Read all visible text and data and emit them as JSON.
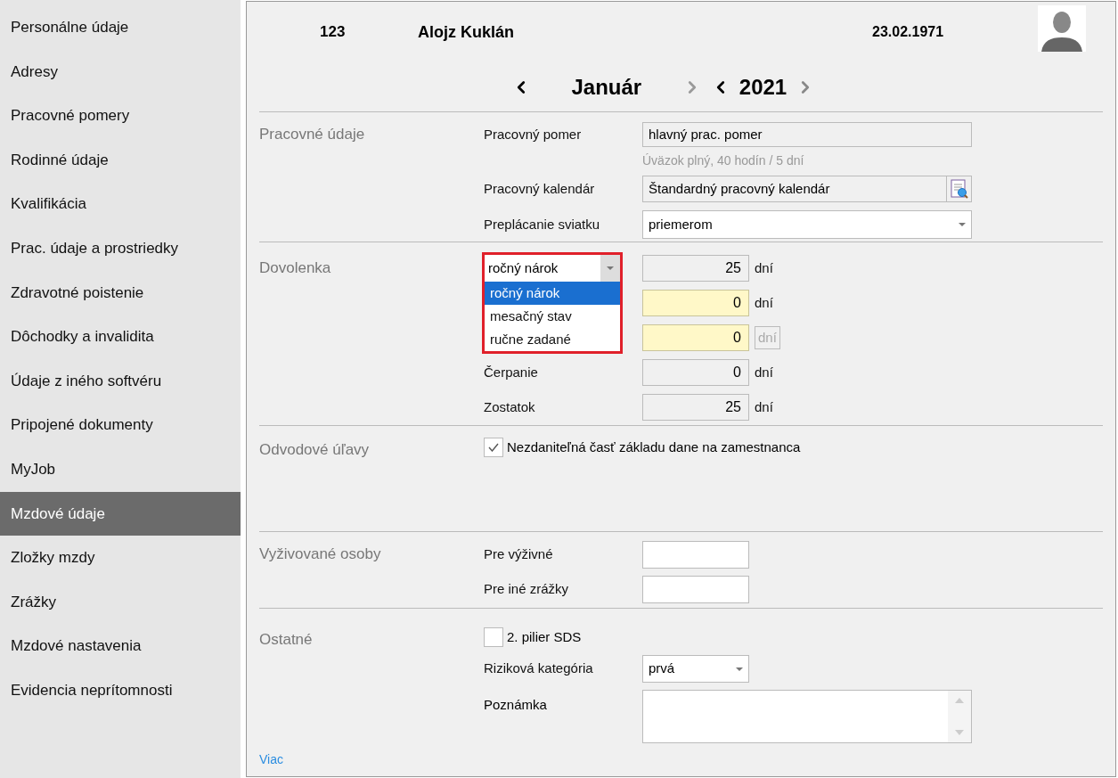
{
  "sidebar": {
    "items": [
      {
        "label": "Personálne údaje",
        "selected": false
      },
      {
        "label": "Adresy",
        "selected": false
      },
      {
        "label": "Pracovné pomery",
        "selected": false
      },
      {
        "label": "Rodinné údaje",
        "selected": false
      },
      {
        "label": "Kvalifikácia",
        "selected": false
      },
      {
        "label": "Prac. údaje a prostriedky",
        "selected": false
      },
      {
        "label": "Zdravotné poistenie",
        "selected": false
      },
      {
        "label": "Dôchodky a invalidita",
        "selected": false
      },
      {
        "label": "Údaje z iného softvéru",
        "selected": false
      },
      {
        "label": "Pripojené dokumenty",
        "selected": false
      },
      {
        "label": "MyJob",
        "selected": false
      },
      {
        "label": "Mzdové údaje",
        "selected": true
      },
      {
        "label": "Zložky mzdy",
        "selected": false
      },
      {
        "label": "Zrážky",
        "selected": false
      },
      {
        "label": "Mzdové nastavenia",
        "selected": false
      },
      {
        "label": "Evidencia neprítomnosti",
        "selected": false
      }
    ]
  },
  "header": {
    "number": "123",
    "name": "Alojz Kuklán",
    "birth_date": "23.02.1971"
  },
  "period": {
    "month": "Január",
    "year": "2021",
    "next_month_disabled": true
  },
  "work": {
    "title": "Pracovné údaje",
    "relation_label": "Pracovný pomer",
    "relation_value": "hlavný prac. pomer",
    "relation_note": "Úväzok plný, 40 hodín  / 5 dní",
    "calendar_label": "Pracovný kalendár",
    "calendar_value": "Štandardný pracovný kalendár",
    "holiday_label": "Preplácanie sviatku",
    "holiday_value": "priemerom"
  },
  "vacation": {
    "title": "Dovolenka",
    "mode_value": "ročný nárok",
    "options": [
      {
        "label": "ročný nárok",
        "selected": true
      },
      {
        "label": "mesačný stav",
        "selected": false
      },
      {
        "label": "ručne zadané",
        "selected": false
      }
    ],
    "rows": [
      {
        "value": "25",
        "unit": "dní",
        "editable": false,
        "unit_disabled": false
      },
      {
        "value": "0",
        "unit": "dní",
        "editable": true,
        "unit_disabled": false
      },
      {
        "value": "0",
        "unit": "dní",
        "editable": true,
        "unit_disabled": true
      },
      {
        "label": "Čerpanie",
        "value": "0",
        "unit": "dní",
        "editable": false,
        "unit_disabled": false
      },
      {
        "label": "Zostatok",
        "value": "25",
        "unit": "dní",
        "editable": false,
        "unit_disabled": false
      }
    ]
  },
  "relief": {
    "title": "Odvodové úľavy",
    "checkbox_label": "Nezdaniteľná časť základu dane na zamestnanca",
    "checked": true
  },
  "dependents": {
    "title": "Vyživované osoby",
    "rows": [
      {
        "label": "Pre výživné"
      },
      {
        "label": "Pre iné zrážky"
      }
    ]
  },
  "other": {
    "title": "Ostatné",
    "pillar_label": "2. pilier SDS",
    "pillar_checked": false,
    "risk_label": "Riziková kategória",
    "risk_value": "prvá",
    "note_label": "Poznámka"
  },
  "more_link": "Viac"
}
